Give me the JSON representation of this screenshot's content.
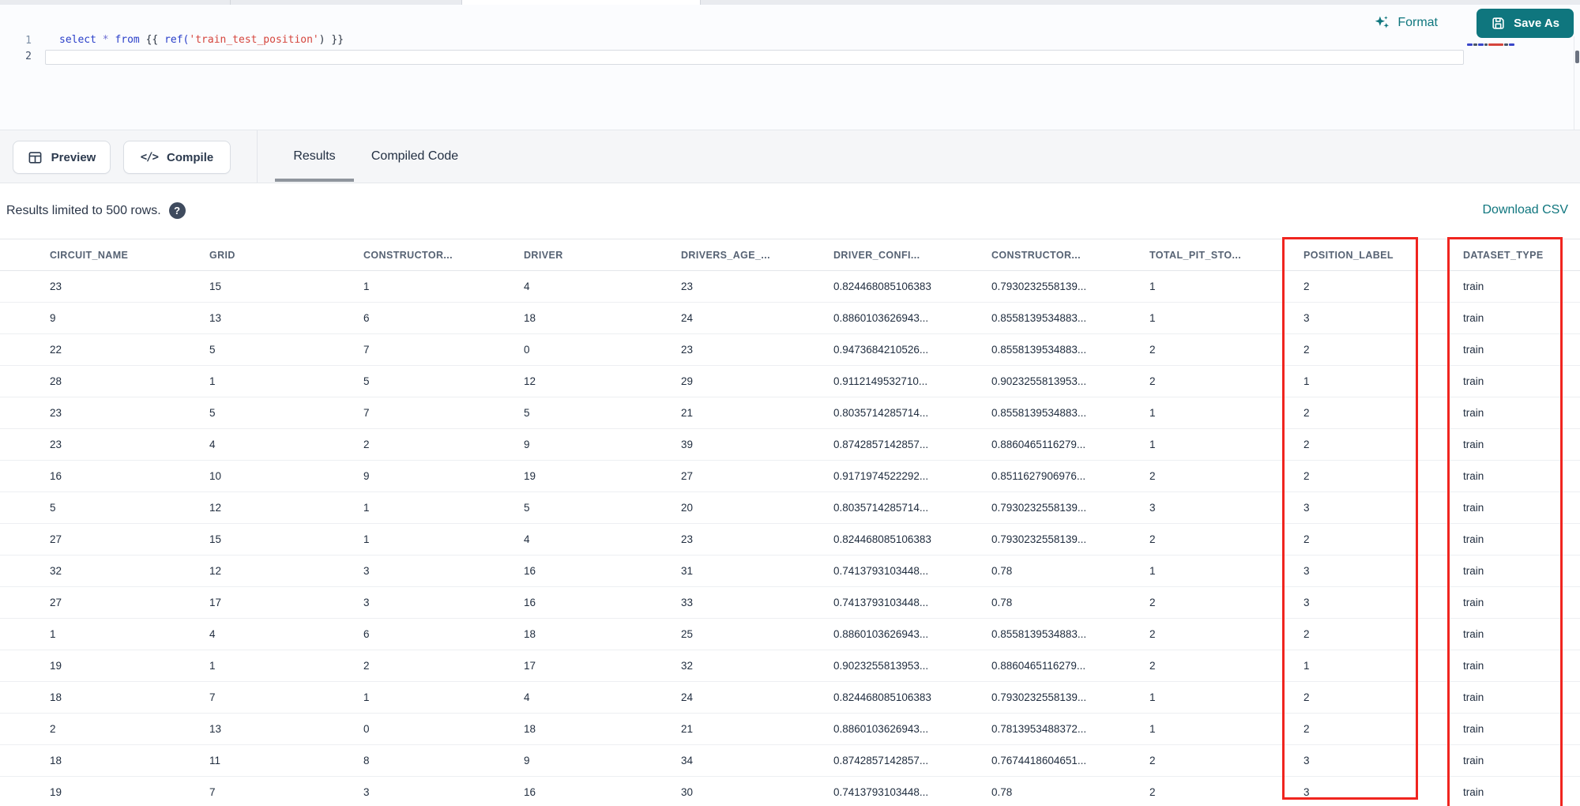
{
  "colors": {
    "accent": "#0f767e",
    "annotation": "#f0251f"
  },
  "editor": {
    "format_label": "Format",
    "save_as_label": "Save As",
    "lines": [
      {
        "number": "1",
        "tokens": [
          {
            "t": "select",
            "c": "kw"
          },
          {
            "t": " ",
            "c": "pl"
          },
          {
            "t": "*",
            "c": "op"
          },
          {
            "t": " ",
            "c": "pl"
          },
          {
            "t": "from",
            "c": "kw"
          },
          {
            "t": " ",
            "c": "pl"
          },
          {
            "t": "{{",
            "c": "br"
          },
          {
            "t": " ",
            "c": "pl"
          },
          {
            "t": "ref(",
            "c": "fn"
          },
          {
            "t": "'train_test_position'",
            "c": "str"
          },
          {
            "t": ")",
            "c": "br"
          },
          {
            "t": " ",
            "c": "pl"
          },
          {
            "t": "}}",
            "c": "br"
          }
        ]
      },
      {
        "number": "2",
        "tokens": []
      }
    ]
  },
  "toolbar": {
    "preview_label": "Preview",
    "compile_label": "Compile",
    "compile_icon_glyph": "</>",
    "tabs": [
      {
        "label": "Results",
        "active": true
      },
      {
        "label": "Compiled Code",
        "active": false
      }
    ]
  },
  "status": {
    "text": "Results limited to 500 rows.",
    "help_icon_glyph": "?",
    "download_csv_label": "Download CSV"
  },
  "table": {
    "columns": [
      "CIRCUIT_NAME",
      "GRID",
      "CONSTRUCTOR...",
      "DRIVER",
      "DRIVERS_AGE_...",
      "DRIVER_CONFI...",
      "CONSTRUCTOR...",
      "TOTAL_PIT_STO...",
      "POSITION_LABEL",
      "DATASET_TYPE"
    ],
    "rows": [
      [
        "23",
        "15",
        "1",
        "4",
        "23",
        "0.824468085106383",
        "0.7930232558139...",
        "1",
        "2",
        "train"
      ],
      [
        "9",
        "13",
        "6",
        "18",
        "24",
        "0.8860103626943...",
        "0.8558139534883...",
        "1",
        "3",
        "train"
      ],
      [
        "22",
        "5",
        "7",
        "0",
        "23",
        "0.9473684210526...",
        "0.8558139534883...",
        "2",
        "2",
        "train"
      ],
      [
        "28",
        "1",
        "5",
        "12",
        "29",
        "0.9112149532710...",
        "0.9023255813953...",
        "2",
        "1",
        "train"
      ],
      [
        "23",
        "5",
        "7",
        "5",
        "21",
        "0.8035714285714...",
        "0.8558139534883...",
        "1",
        "2",
        "train"
      ],
      [
        "23",
        "4",
        "2",
        "9",
        "39",
        "0.8742857142857...",
        "0.8860465116279...",
        "1",
        "2",
        "train"
      ],
      [
        "16",
        "10",
        "9",
        "19",
        "27",
        "0.9171974522292...",
        "0.8511627906976...",
        "2",
        "2",
        "train"
      ],
      [
        "5",
        "12",
        "1",
        "5",
        "20",
        "0.8035714285714...",
        "0.7930232558139...",
        "3",
        "3",
        "train"
      ],
      [
        "27",
        "15",
        "1",
        "4",
        "23",
        "0.824468085106383",
        "0.7930232558139...",
        "2",
        "2",
        "train"
      ],
      [
        "32",
        "12",
        "3",
        "16",
        "31",
        "0.7413793103448...",
        "0.78",
        "1",
        "3",
        "train"
      ],
      [
        "27",
        "17",
        "3",
        "16",
        "33",
        "0.7413793103448...",
        "0.78",
        "2",
        "3",
        "train"
      ],
      [
        "1",
        "4",
        "6",
        "18",
        "25",
        "0.8860103626943...",
        "0.8558139534883...",
        "2",
        "2",
        "train"
      ],
      [
        "19",
        "1",
        "2",
        "17",
        "32",
        "0.9023255813953...",
        "0.8860465116279...",
        "2",
        "1",
        "train"
      ],
      [
        "18",
        "7",
        "1",
        "4",
        "24",
        "0.824468085106383",
        "0.7930232558139...",
        "1",
        "2",
        "train"
      ],
      [
        "2",
        "13",
        "0",
        "18",
        "21",
        "0.8860103626943...",
        "0.7813953488372...",
        "1",
        "2",
        "train"
      ],
      [
        "18",
        "11",
        "8",
        "9",
        "34",
        "0.8742857142857...",
        "0.7674418604651...",
        "2",
        "3",
        "train"
      ],
      [
        "19",
        "7",
        "3",
        "16",
        "30",
        "0.7413793103448...",
        "0.78",
        "2",
        "3",
        "train"
      ]
    ]
  },
  "annotations": {
    "color": "#f0251f",
    "highlighted_columns": [
      "POSITION_LABEL",
      "DATASET_TYPE"
    ]
  }
}
